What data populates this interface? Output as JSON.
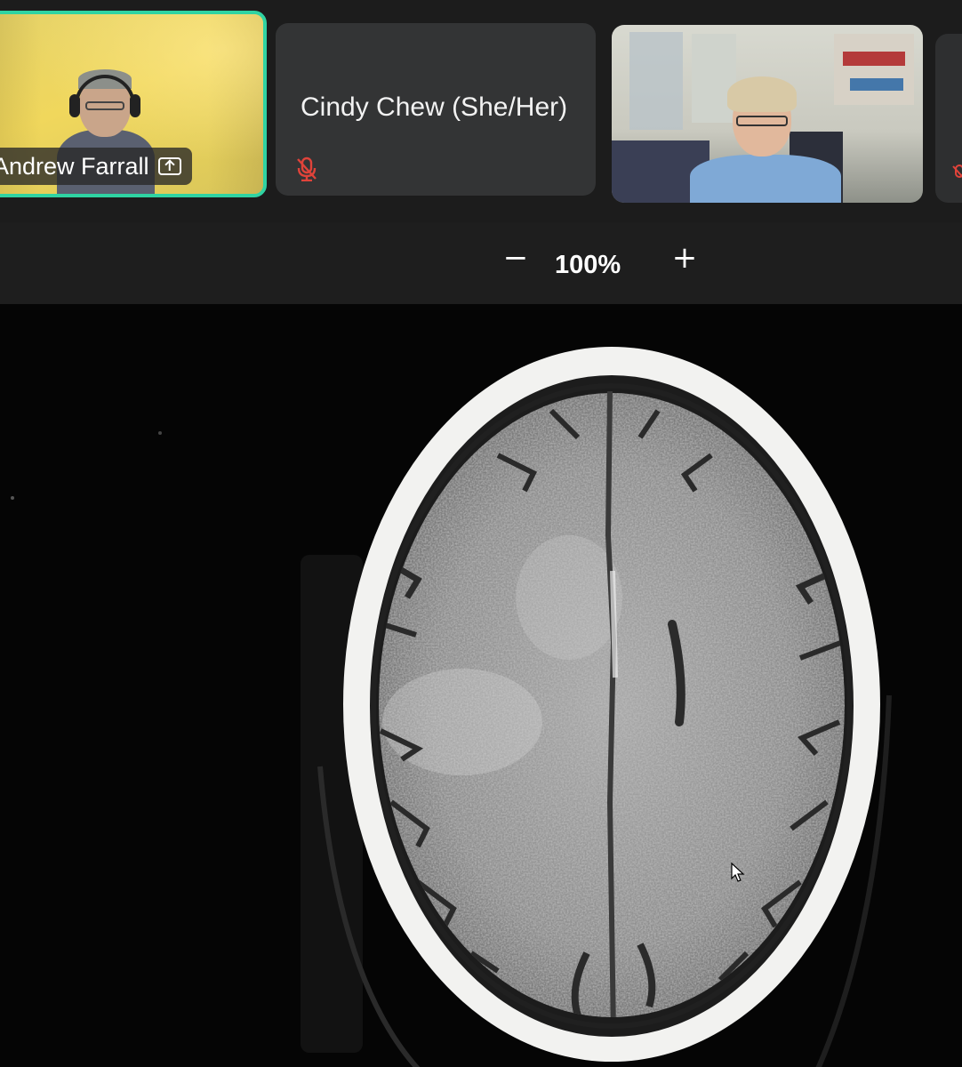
{
  "gallery": {
    "participants": [
      {
        "name": "Andrew Farrall",
        "sharing": true,
        "active_speaker": true,
        "icon": "screen-share-icon"
      },
      {
        "name": "Cindy Chew (She/Her)",
        "muted": true,
        "video_off": true,
        "icon": "mic-muted-icon"
      },
      {
        "name": "",
        "muted": false,
        "video_off": false
      },
      {
        "name": "",
        "muted": true,
        "video_off": true,
        "icon": "mic-muted-icon"
      }
    ]
  },
  "zoom": {
    "minus_label": "−",
    "level": "100%",
    "plus_label": "+"
  },
  "shared_content": {
    "image_type": "axial CT head scan",
    "cursor_icon": "mouse-pointer-icon"
  },
  "colors": {
    "active_speaker_border": "#2fd3a2",
    "muted_icon": "#e0433a",
    "tile_background": "#333435"
  }
}
